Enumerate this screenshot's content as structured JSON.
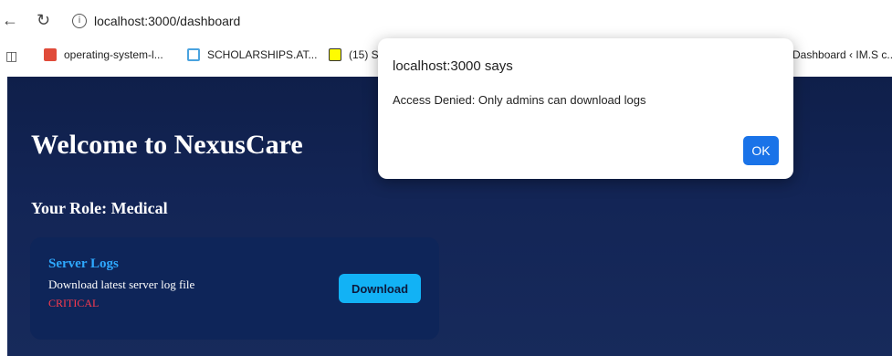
{
  "browser": {
    "url": "localhost:3000/dashboard",
    "bookmarks": [
      {
        "label": "operating-system-l...",
        "icon": "pdf-icon",
        "color": "#e04b3a"
      },
      {
        "label": "SCHOLARSHIPS.AT...",
        "icon": "page-icon",
        "color": "#4aa3df"
      },
      {
        "label": "(15) S",
        "icon": "snapchat-icon",
        "color": "#fffc00"
      },
      {
        "label": "Dashboard ‹ IM.S c...",
        "icon": "site-icon",
        "color": "#888888"
      }
    ]
  },
  "page": {
    "title": "Welcome to NexusCare",
    "role": "Your Role: Medical",
    "card": {
      "title": "Server Logs",
      "description": "Download latest server log file",
      "level": "CRITICAL",
      "button": "Download"
    }
  },
  "dialog": {
    "title": "localhost:3000 says",
    "message": "Access Denied: Only admins can download logs",
    "ok": "OK"
  },
  "colors": {
    "page_background": "#132556",
    "card_background": "#0e2559",
    "card_title": "#2ea9ff",
    "critical": "#ff3b4e",
    "download_button": "#12b2f5",
    "ok_button": "#1a73e8"
  }
}
